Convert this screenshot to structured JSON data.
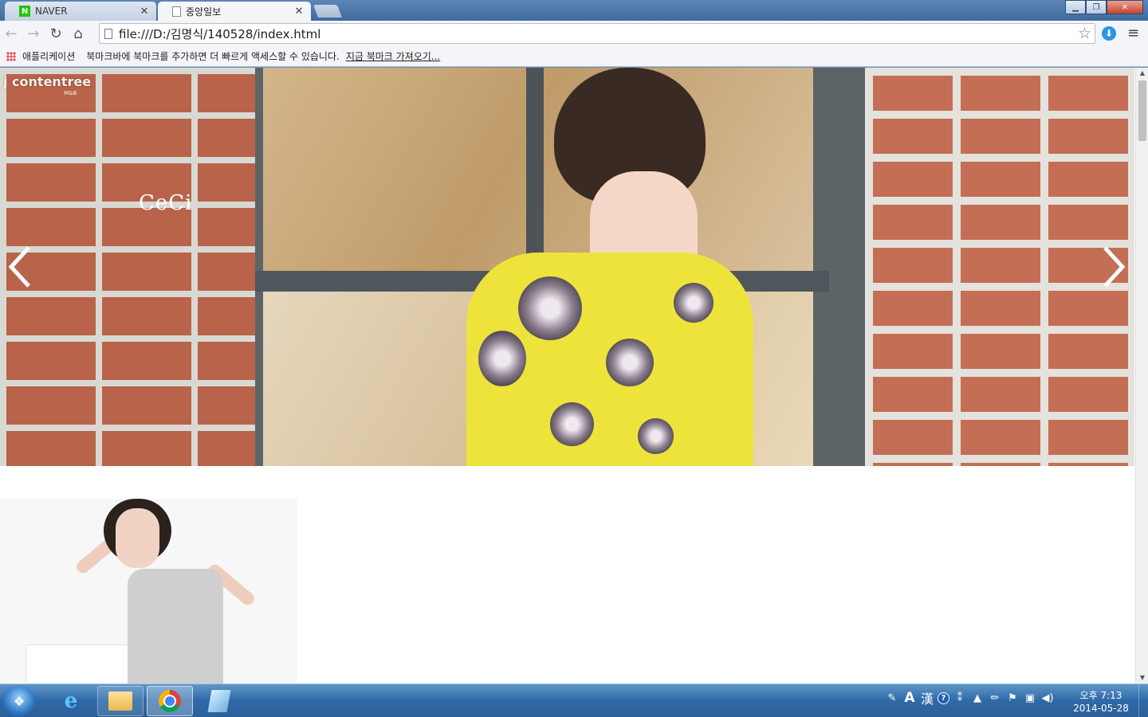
{
  "browser": {
    "tabs": [
      {
        "label": "NAVER",
        "favicon": "N",
        "active": false
      },
      {
        "label": "중앙일보",
        "favicon": "",
        "active": true
      }
    ],
    "url": "file:///D:/김명식/140528/index.html",
    "bookmarks": {
      "apps_label": "애플리케이션",
      "hint": "북마크바에 북마크를 추가하면 더 빠르게 액세스할 수 있습니다.",
      "import_link": "지금 북마크 가져오기..."
    }
  },
  "page": {
    "hero": {
      "watermark": "j contentree",
      "watermark_sub": "M&B",
      "logo_text": "CeCi"
    }
  },
  "taskbar": {
    "ime_mode": "A",
    "ime_hanja": "漢",
    "clock": {
      "time": "오후 7:13",
      "date": "2014-05-28"
    }
  },
  "colors": {
    "taskbar": "#2e6aa7",
    "dress_yellow": "#eee33b"
  }
}
